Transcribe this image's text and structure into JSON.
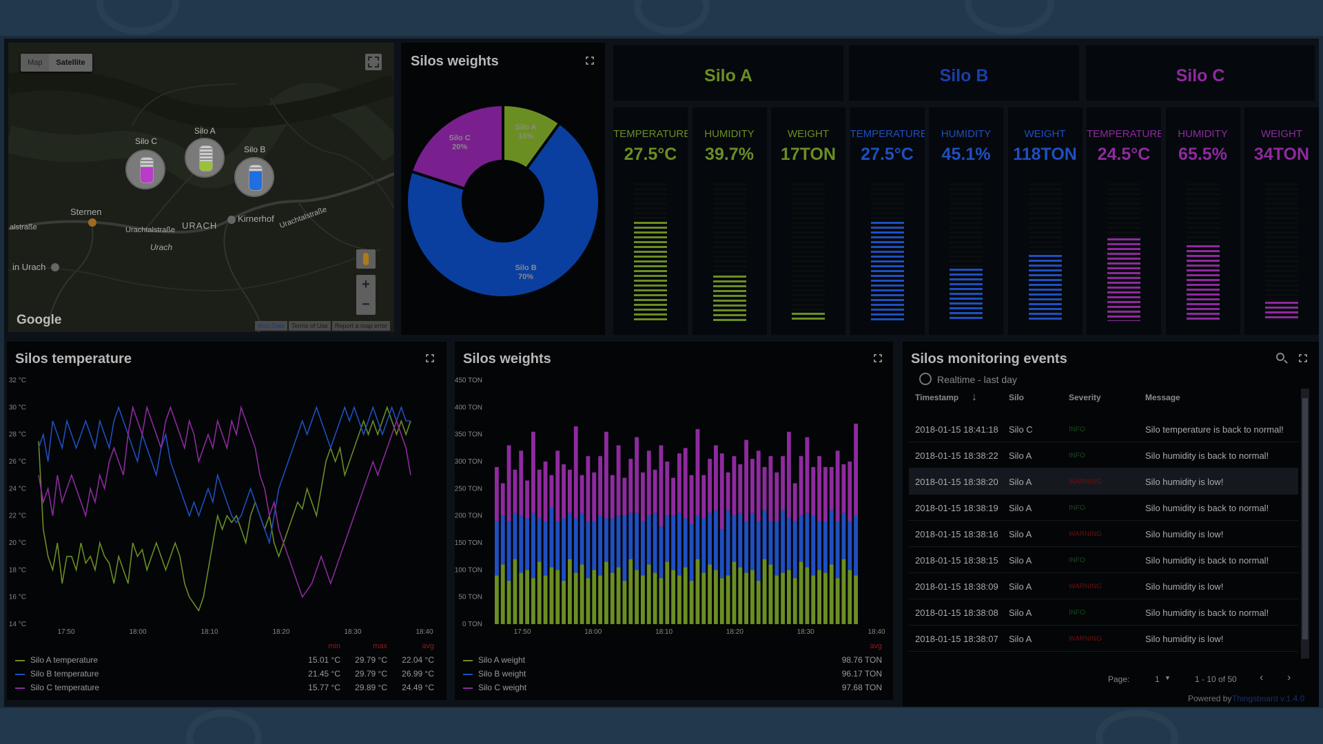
{
  "map": {
    "btn_map": "Map",
    "btn_satellite": "Satellite",
    "places": [
      "Sternen",
      "URACH",
      "Kirnerhof",
      "Urachtalstraße",
      "Urachtalstraße",
      "Urach",
      "in Urach",
      "alstraße"
    ],
    "markers": [
      {
        "label": "Silo C",
        "color": "#b83cc8"
      },
      {
        "label": "Silo A",
        "color": "#9bc03a"
      },
      {
        "label": "Silo B",
        "color": "#1f6fe0"
      }
    ],
    "logo": "Google",
    "footer": [
      "Map Data",
      "Terms of Use",
      "Report a map error"
    ],
    "zoom_in": "+",
    "zoom_out": "−"
  },
  "pie": {
    "title": "Silos weights",
    "chart_data": {
      "type": "pie",
      "slices": [
        {
          "name": "Silo A",
          "label": "10%",
          "value": 10,
          "color": "#6b8e23"
        },
        {
          "name": "Silo B",
          "label": "70%",
          "value": 70,
          "color": "#0a3fa0"
        },
        {
          "name": "Silo C",
          "label": "20%",
          "value": 20,
          "color": "#7a1f8e"
        }
      ]
    }
  },
  "silos": {
    "headers": [
      {
        "name": "Silo A",
        "color": "#6b8e23"
      },
      {
        "name": "Silo B",
        "color": "#1a3fa8"
      },
      {
        "name": "Silo C",
        "color": "#8e2a9e"
      }
    ],
    "columns": [
      {
        "label": "TEMPERATURE",
        "value": "27.5°C",
        "level": 0.72,
        "color": "#6b8e23"
      },
      {
        "label": "HUMIDITY",
        "value": "39.7%",
        "level": 0.33,
        "color": "#6b8e23"
      },
      {
        "label": "WEIGHT",
        "value": "17TON",
        "level": 0.06,
        "color": "#6b8e23"
      },
      {
        "label": "TEMPERATURE",
        "value": "27.5°C",
        "level": 0.72,
        "color": "#1f4fc0"
      },
      {
        "label": "HUMIDITY",
        "value": "45.1%",
        "level": 0.38,
        "color": "#1f4fc0"
      },
      {
        "label": "WEIGHT",
        "value": "118TON",
        "level": 0.48,
        "color": "#1f4fc0"
      },
      {
        "label": "TEMPERATURE",
        "value": "24.5°C",
        "level": 0.6,
        "color": "#8e2a9e"
      },
      {
        "label": "HUMIDITY",
        "value": "65.5%",
        "level": 0.55,
        "color": "#8e2a9e"
      },
      {
        "label": "WEIGHT",
        "value": "34TON",
        "level": 0.14,
        "color": "#8e2a9e"
      }
    ]
  },
  "temp": {
    "title": "Silos temperature",
    "stat_headers": [
      "min",
      "max",
      "avg"
    ],
    "legend": [
      {
        "name": "Silo A temperature",
        "color": "#6b8e23",
        "min": "15.01 °C",
        "max": "29.79 °C",
        "avg": "22.04 °C"
      },
      {
        "name": "Silo B temperature",
        "color": "#1f4fc0",
        "min": "21.45 °C",
        "max": "29.79 °C",
        "avg": "26.99 °C"
      },
      {
        "name": "Silo C temperature",
        "color": "#8e2a9e",
        "min": "15.77 °C",
        "max": "29.89 °C",
        "avg": "24.49 °C"
      }
    ],
    "chart_data": {
      "type": "line",
      "yticks": [
        "32 °C",
        "30 °C",
        "28 °C",
        "26 °C",
        "24 °C",
        "22 °C",
        "20 °C",
        "18 °C",
        "16 °C",
        "14 °C"
      ],
      "xticks": [
        "17:50",
        "18:00",
        "18:10",
        "18:20",
        "18:30",
        "18:40"
      ],
      "ylim": [
        14,
        32
      ],
      "series": [
        {
          "name": "Silo A temperature",
          "color": "#6b8e23",
          "values": [
            27.5,
            21,
            19,
            18,
            20,
            17,
            19,
            19,
            18,
            20,
            18.5,
            19,
            18,
            20,
            19,
            18.5,
            17,
            19,
            18,
            17,
            20,
            19,
            19.5,
            18,
            19,
            20,
            19,
            18,
            19,
            20,
            19,
            17,
            16,
            15.5,
            15,
            16,
            18,
            20,
            22,
            21,
            22,
            21.5,
            22,
            21,
            20,
            22,
            23,
            22,
            21,
            22,
            20,
            19,
            20,
            21,
            22,
            23,
            22.5,
            24,
            23,
            22,
            24,
            26,
            27,
            26,
            27,
            25,
            26,
            27,
            28,
            29,
            28,
            29,
            28,
            29,
            30,
            29,
            28,
            29,
            28,
            29
          ]
        },
        {
          "name": "Silo B temperature",
          "color": "#1f4fc0",
          "values": [
            27,
            28,
            26,
            29,
            28,
            27,
            29,
            28,
            27,
            28,
            29,
            28,
            27,
            29,
            28,
            27,
            29,
            30,
            29,
            28,
            27,
            26,
            28,
            27,
            26,
            25,
            27,
            28,
            26,
            25,
            24,
            23,
            22,
            23,
            22,
            23,
            24,
            23,
            25,
            24,
            23,
            22,
            21.5,
            22,
            23,
            24,
            23,
            22,
            21,
            20,
            22,
            24,
            25,
            26,
            27,
            28,
            29,
            28,
            29,
            30,
            29,
            28,
            27,
            28,
            29,
            30,
            29,
            30,
            29,
            28,
            29,
            30,
            29,
            28,
            29,
            30,
            29,
            30,
            29,
            29
          ]
        },
        {
          "name": "Silo C temperature",
          "color": "#8e2a9e",
          "values": [
            25,
            23,
            24,
            22,
            25,
            23,
            24,
            25,
            24,
            23,
            22,
            24,
            23,
            25,
            24,
            26,
            27,
            26,
            25,
            28,
            30,
            29,
            28,
            30,
            29,
            28,
            27,
            29,
            30,
            29,
            28,
            27,
            29,
            28,
            26,
            27,
            28,
            27,
            29,
            28,
            27,
            29,
            28,
            30,
            29,
            28,
            27,
            25,
            24,
            22,
            23,
            21,
            20,
            19,
            18,
            17,
            16,
            16.5,
            17,
            18,
            19,
            18,
            17,
            18,
            19,
            20,
            21,
            22,
            23,
            24,
            25,
            26,
            25,
            26,
            27,
            28,
            29,
            28,
            27,
            25
          ]
        }
      ]
    }
  },
  "wbars": {
    "title": "Silos weights",
    "stat_headers": [
      "avg"
    ],
    "legend": [
      {
        "name": "Silo A weight",
        "color": "#6b8e23",
        "avg": "98.76 TON"
      },
      {
        "name": "Silo B weight",
        "color": "#1f4fc0",
        "avg": "96.17 TON"
      },
      {
        "name": "Silo C weight",
        "color": "#8e2a9e",
        "avg": "97.68 TON"
      }
    ],
    "chart_data": {
      "type": "bar",
      "stacked": true,
      "yticks": [
        "450 TON",
        "400 TON",
        "350 TON",
        "300 TON",
        "250 TON",
        "200 TON",
        "150 TON",
        "100 TON",
        "50 TON",
        "0 TON"
      ],
      "xticks": [
        "17:50",
        "18:00",
        "18:10",
        "18:20",
        "18:30",
        "18:40"
      ],
      "ylim": [
        0,
        450
      ],
      "series": [
        {
          "name": "Silo A weight",
          "color": "#6b8e23",
          "values": [
            90,
            110,
            80,
            120,
            95,
            100,
            85,
            115,
            90,
            105,
            100,
            80,
            120,
            95,
            110,
            85,
            100,
            90,
            115,
            95,
            105,
            80,
            120,
            100,
            90,
            110,
            95,
            85,
            115,
            100,
            90,
            105,
            80,
            120,
            95,
            110,
            100,
            85,
            90,
            115,
            105,
            95,
            100,
            80,
            120,
            110,
            90,
            95,
            100,
            85,
            115,
            105,
            90,
            100,
            95,
            110,
            85,
            120,
            100,
            90
          ]
        },
        {
          "name": "Silo B weight",
          "color": "#1f4fc0",
          "values": [
            100,
            90,
            110,
            85,
            105,
            95,
            120,
            80,
            100,
            110,
            90,
            115,
            85,
            100,
            95,
            105,
            90,
            110,
            80,
            100,
            95,
            120,
            85,
            105,
            100,
            90,
            110,
            95,
            85,
            100,
            115,
            90,
            105,
            80,
            100,
            95,
            110,
            90,
            120,
            85,
            100,
            95,
            105,
            110,
            90,
            80,
            100,
            115,
            95,
            105,
            85,
            100,
            110,
            90,
            95,
            100,
            105,
            85,
            90,
            110
          ]
        },
        {
          "name": "Silo C weight",
          "color": "#8e2a9e",
          "values": [
            100,
            60,
            140,
            80,
            120,
            70,
            150,
            90,
            110,
            60,
            130,
            100,
            80,
            170,
            70,
            120,
            90,
            110,
            160,
            80,
            130,
            70,
            100,
            140,
            90,
            120,
            80,
            150,
            100,
            70,
            110,
            130,
            90,
            160,
            80,
            100,
            120,
            140,
            70,
            110,
            90,
            150,
            100,
            130,
            80,
            120,
            90,
            100,
            160,
            70,
            110,
            140,
            90,
            120,
            100,
            80,
            130,
            90,
            110,
            170
          ]
        }
      ]
    }
  },
  "events": {
    "title": "Silos monitoring events",
    "timewindow": "Realtime - last day",
    "columns": [
      "Timestamp",
      "Silo",
      "Severity",
      "Message"
    ],
    "rows": [
      {
        "ts": "2018-01-15 18:41:18",
        "silo": "Silo C",
        "sev": "INFO",
        "msg": "Silo temperature is back to normal!"
      },
      {
        "ts": "2018-01-15 18:38:22",
        "silo": "Silo A",
        "sev": "INFO",
        "msg": "Silo humidity is back to normal!"
      },
      {
        "ts": "2018-01-15 18:38:20",
        "silo": "Silo A",
        "sev": "WARNING",
        "msg": "Silo humidity is low!"
      },
      {
        "ts": "2018-01-15 18:38:19",
        "silo": "Silo A",
        "sev": "INFO",
        "msg": "Silo humidity is back to normal!"
      },
      {
        "ts": "2018-01-15 18:38:16",
        "silo": "Silo A",
        "sev": "WARNING",
        "msg": "Silo humidity is low!"
      },
      {
        "ts": "2018-01-15 18:38:15",
        "silo": "Silo A",
        "sev": "INFO",
        "msg": "Silo humidity is back to normal!"
      },
      {
        "ts": "2018-01-15 18:38:09",
        "silo": "Silo A",
        "sev": "WARNING",
        "msg": "Silo humidity is low!"
      },
      {
        "ts": "2018-01-15 18:38:08",
        "silo": "Silo A",
        "sev": "INFO",
        "msg": "Silo humidity is back to normal!"
      },
      {
        "ts": "2018-01-15 18:38:07",
        "silo": "Silo A",
        "sev": "WARNING",
        "msg": "Silo humidity is low!"
      }
    ],
    "pager": {
      "label": "Page:",
      "page": "1",
      "range": "1 - 10 of 50"
    },
    "powered_by": "Powered by",
    "powered_link": "Thingsboard v.1.4.0"
  }
}
